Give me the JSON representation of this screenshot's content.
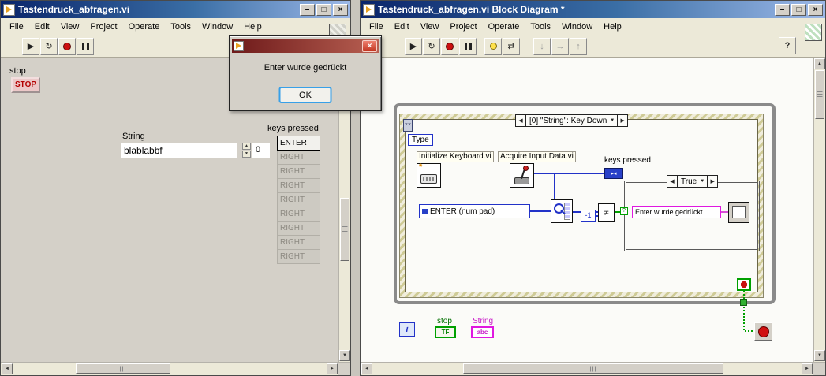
{
  "menu": [
    "File",
    "Edit",
    "View",
    "Project",
    "Operate",
    "Tools",
    "Window",
    "Help"
  ],
  "front_panel": {
    "window_title": "Tastendruck_abfragen.vi",
    "stop_label": "stop",
    "stop_button": "STOP",
    "string_label": "String",
    "string_value": "blablabbf",
    "numeric_value": "0",
    "keys_pressed_label": "keys pressed",
    "keys": [
      {
        "text": "ENTER",
        "enabled": true
      },
      {
        "text": "RIGHT",
        "enabled": false
      },
      {
        "text": "RIGHT",
        "enabled": false
      },
      {
        "text": "RIGHT",
        "enabled": false
      },
      {
        "text": "RIGHT",
        "enabled": false
      },
      {
        "text": "RIGHT",
        "enabled": false
      },
      {
        "text": "RIGHT",
        "enabled": false
      },
      {
        "text": "RIGHT",
        "enabled": false
      },
      {
        "text": "RIGHT",
        "enabled": false
      }
    ]
  },
  "dialog": {
    "message": "Enter wurde gedrückt",
    "ok_label": "OK"
  },
  "block_diagram": {
    "window_title": "Tastendruck_abfragen.vi Block Diagram *",
    "event_header": "[0] \"String\": Key Down",
    "type_label": "Type",
    "init_vi_label": "Initialize Keyboard.vi",
    "acquire_vi_label": "Acquire Input Data.vi",
    "keys_pressed_label": "keys pressed",
    "enum_constant": "ENTER (num pad)",
    "minus_one": "-1",
    "not_equal_symbol": "≠",
    "case_header": "True",
    "case_string_constant": "Enter wurde gedrückt",
    "iteration_terminal": "i",
    "stop_terminal_label": "stop",
    "stop_terminal_text": "TF",
    "string_terminal_label": "String",
    "string_terminal_text": "abc"
  },
  "icons": {
    "minimize": "–",
    "maximize": "□",
    "close": "×",
    "run": "▶",
    "run_continuous": "↻",
    "step_into": "↓",
    "step_over": "→",
    "step_out": "↑",
    "retain_wire_values": "⇄",
    "help": "?",
    "scroll_up": "▲",
    "scroll_down": "▼",
    "scroll_left": "◄",
    "scroll_right": "►",
    "selector_prev": "◀",
    "selector_next": "▶",
    "selector_dropdown": "▼",
    "spin_up": "▲",
    "spin_down": "▼",
    "question": "?"
  },
  "colors": {
    "titlebar_active": "#0A246A",
    "dialog_titlebar": "#6E1A1A",
    "boolean_green": "#00A000",
    "string_pink": "#E018E0",
    "numeric_blue": "#2232C8",
    "abort_red": "#CC1010"
  }
}
